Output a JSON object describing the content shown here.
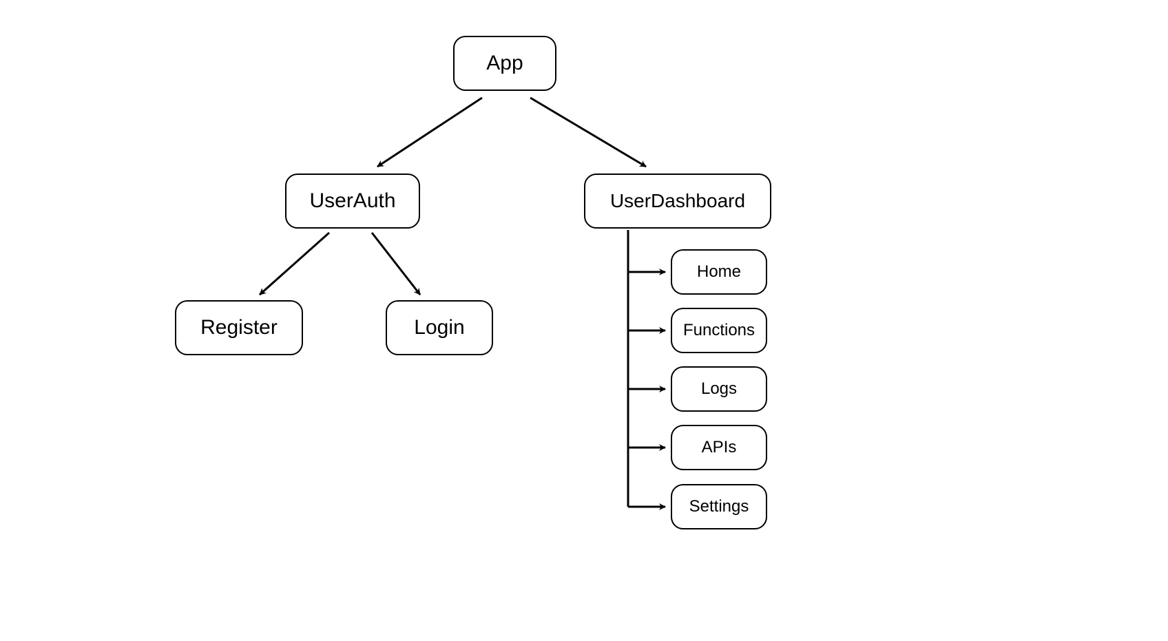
{
  "diagram": {
    "root": "App",
    "userAuth": {
      "label": "UserAuth",
      "children": {
        "register": "Register",
        "login": "Login"
      }
    },
    "userDashboard": {
      "label": "UserDashboard",
      "items": [
        "Home",
        "Functions",
        "Logs",
        "APIs",
        "Settings"
      ]
    }
  }
}
